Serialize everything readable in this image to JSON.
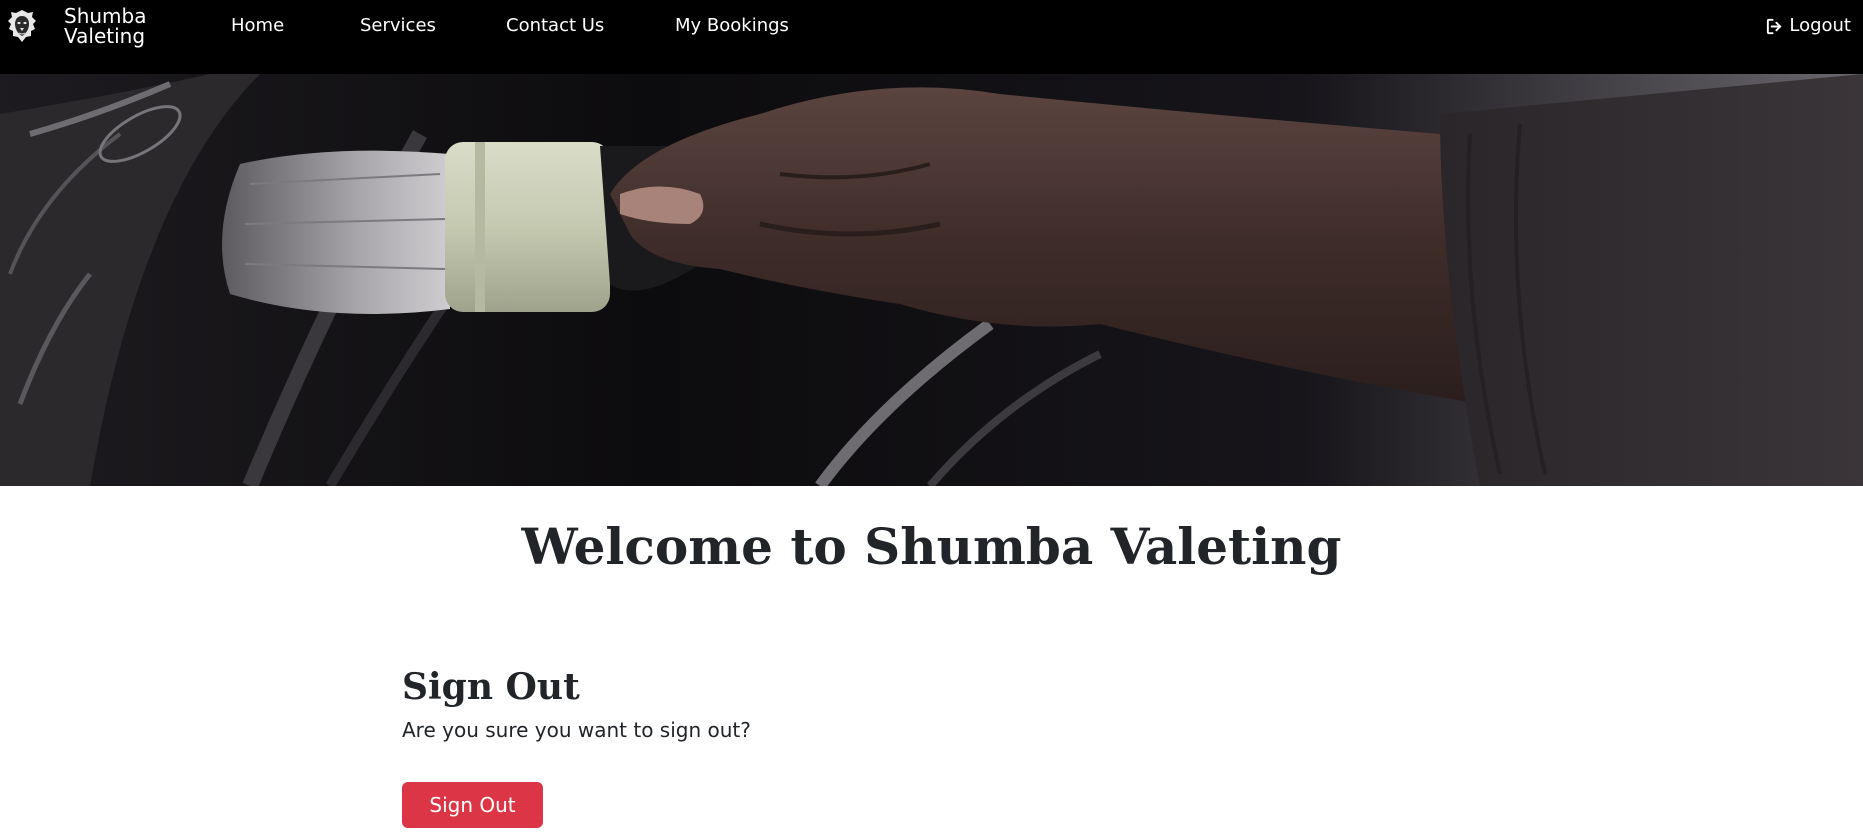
{
  "navbar": {
    "brand": {
      "name": "Shumba\nValeting",
      "logo_icon": "lion-icon"
    },
    "links": [
      {
        "label": "Home"
      },
      {
        "label": "Services"
      },
      {
        "label": "Contact Us"
      },
      {
        "label": "My Bookings"
      }
    ],
    "logout": {
      "label": "Logout",
      "icon": "logout-icon"
    },
    "background": "#000000"
  },
  "hero": {
    "subject": "hand holding detailing brush cleaning a wheel"
  },
  "main": {
    "welcome_heading": "Welcome to Shumba Valeting",
    "signout": {
      "title": "Sign Out",
      "prompt": "Are you sure you want to sign out?",
      "button_label": "Sign Out",
      "button_color": "#dc3545"
    }
  }
}
